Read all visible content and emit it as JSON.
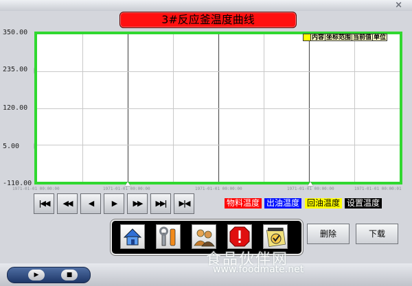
{
  "window": {
    "close_glyph": "×"
  },
  "title": "3#反应釜温度曲线",
  "legend_headers": [
    "内容",
    "坐标范围",
    "当前值",
    "单位"
  ],
  "legend_swatch_color": "#ffff00",
  "chart_data": {
    "type": "line",
    "title": "3#反应釜温度曲线",
    "ylim": [
      -110.0,
      350.0
    ],
    "y_ticks": [
      "350.00",
      "235.00",
      "120.00",
      "5.00",
      "-110.00"
    ],
    "x_ticks": [
      "1971-01-01 00:00:00",
      "1971-01-01 00:00:00",
      "1971-01-01 00:00:00",
      "1971-01-01 00:00:00",
      "1971-01-01 00:00:01"
    ],
    "grid": true,
    "series": [],
    "plot_border_color": "#30d830"
  },
  "nav_buttons": [
    {
      "glyph": "|◀◀",
      "icon": "first-icon"
    },
    {
      "glyph": "◀◀",
      "icon": "fast-back-icon"
    },
    {
      "glyph": "◀",
      "icon": "step-back-icon"
    },
    {
      "glyph": "▶",
      "icon": "step-forward-icon"
    },
    {
      "glyph": "▶▶",
      "icon": "fast-forward-icon"
    },
    {
      "glyph": "▶▶|",
      "icon": "last-icon"
    },
    {
      "glyph": "▶|◀",
      "icon": "end-icon"
    }
  ],
  "series_tags": [
    {
      "label": "物料温度",
      "bg": "#ff0000",
      "fg": "#ffffff"
    },
    {
      "label": "出油温度",
      "bg": "#0010ff",
      "fg": "#ffffff"
    },
    {
      "label": "回油温度",
      "bg": "#ffff00",
      "fg": "#000000"
    },
    {
      "label": "设置温度",
      "bg": "#000000",
      "fg": "#ffffff"
    }
  ],
  "tools": [
    "home-icon",
    "wrench-icon",
    "users-icon",
    "alarm-icon",
    "web-icon"
  ],
  "buttons": {
    "delete": "删除",
    "download": "下载"
  },
  "player": {
    "play": "▶",
    "stop": "■"
  },
  "watermark": {
    "cn": "食品伙伴网",
    "url": "www.foodmate.net"
  }
}
